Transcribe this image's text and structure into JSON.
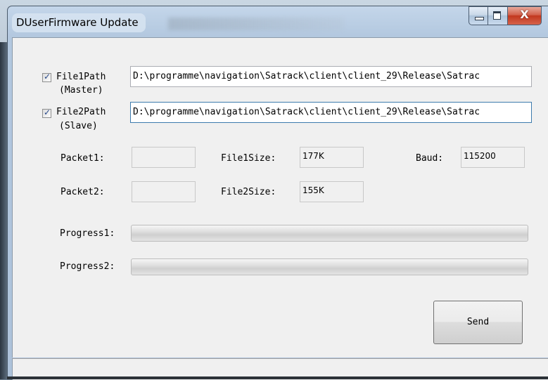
{
  "window": {
    "title": "DUserFirmware Update",
    "close_glyph": "X"
  },
  "files": {
    "file1": {
      "checked": true,
      "label_line1": "File1Path",
      "label_line2": "(Master)",
      "path": "D:\\programme\\navigation\\Satrack\\client\\client_29\\Release\\Satrac"
    },
    "file2": {
      "checked": true,
      "label_line1": "File2Path",
      "label_line2": "(Slave)",
      "path": "D:\\programme\\navigation\\Satrack\\client\\client_29\\Release\\Satrac"
    }
  },
  "info": {
    "packet1_label": "Packet1:",
    "packet1_value": "",
    "packet2_label": "Packet2:",
    "packet2_value": "",
    "file1size_label": "File1Size:",
    "file1size_value": "177K",
    "file2size_label": "File2Size:",
    "file2size_value": "155K",
    "baud_label": "Baud:",
    "baud_value": "115200"
  },
  "progress": {
    "progress1_label": "Progress1:",
    "progress1_value": 0,
    "progress2_label": "Progress2:",
    "progress2_value": 0
  },
  "actions": {
    "send_label": "Send"
  },
  "colors": {
    "progress_fill": "#06b025",
    "close_button": "#c2381f"
  },
  "icons": {
    "checkbox_mark": "✓"
  }
}
